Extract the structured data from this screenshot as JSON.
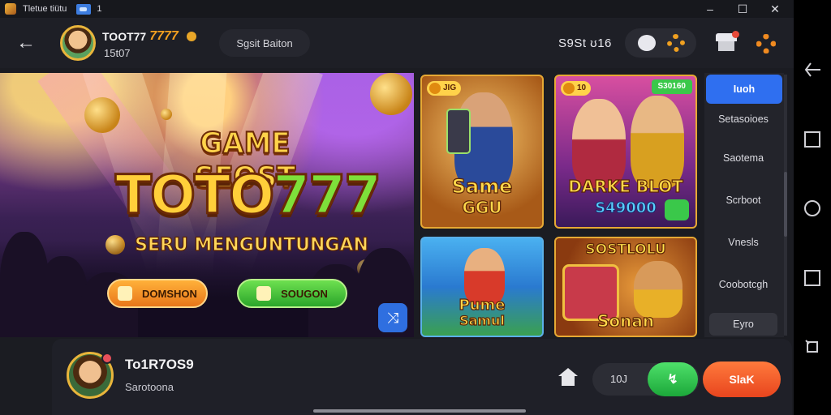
{
  "window": {
    "title": "Tletue tiütu",
    "tab_count": "1",
    "minimize": "–",
    "maximize": "☐",
    "close": "✕"
  },
  "header": {
    "back": "←",
    "username": "TOOT77",
    "username_gold": "7777",
    "user_id": "15t07",
    "search_label": "Sgsit Baiton",
    "balance": "S9St ʊ16"
  },
  "hero": {
    "title_line1": "GAME SEOST",
    "title_line2a": "TOTO",
    "title_line2b": "777",
    "subtitle": "SERU MENGUNTUNGAN",
    "btn_left": "DOMSHON",
    "btn_right": "SOUGON",
    "share": "⤨"
  },
  "cards": [
    {
      "badge": "JIG",
      "label_line1": "Same",
      "label_line2": "GGU"
    },
    {
      "badge": "10",
      "top_tag": "S30160",
      "label_line1": "DARKE BLOT",
      "label_line2": "S49000"
    },
    {
      "label_line1": "Pume",
      "label_line2": "Samul"
    },
    {
      "label_top": "SOSTLOLU",
      "label_line1": "Sonan"
    }
  ],
  "categories": {
    "active": "Iuoh",
    "items": [
      "Setasoioes",
      "Saotema",
      "Scrboot",
      "Vnesls",
      "Coobotcgh"
    ],
    "last": "Eyro"
  },
  "bottom": {
    "name": "To1R7OS9",
    "sub": "Sarotoona",
    "count": "10J",
    "green_btn": "↯",
    "red_btn": "SlaK"
  },
  "colors": {
    "accent_blue": "#2f6ff0",
    "gold": "#e9b53b",
    "green": "#1ca83a",
    "orange": "#e8451e"
  },
  "icons": [
    "back-icon",
    "coin-icon",
    "chat-icon",
    "gear-icon",
    "shop-icon",
    "settings-icon",
    "share-icon",
    "home-icon",
    "nav-back-icon",
    "nav-home-icon",
    "nav-recent-icon"
  ]
}
